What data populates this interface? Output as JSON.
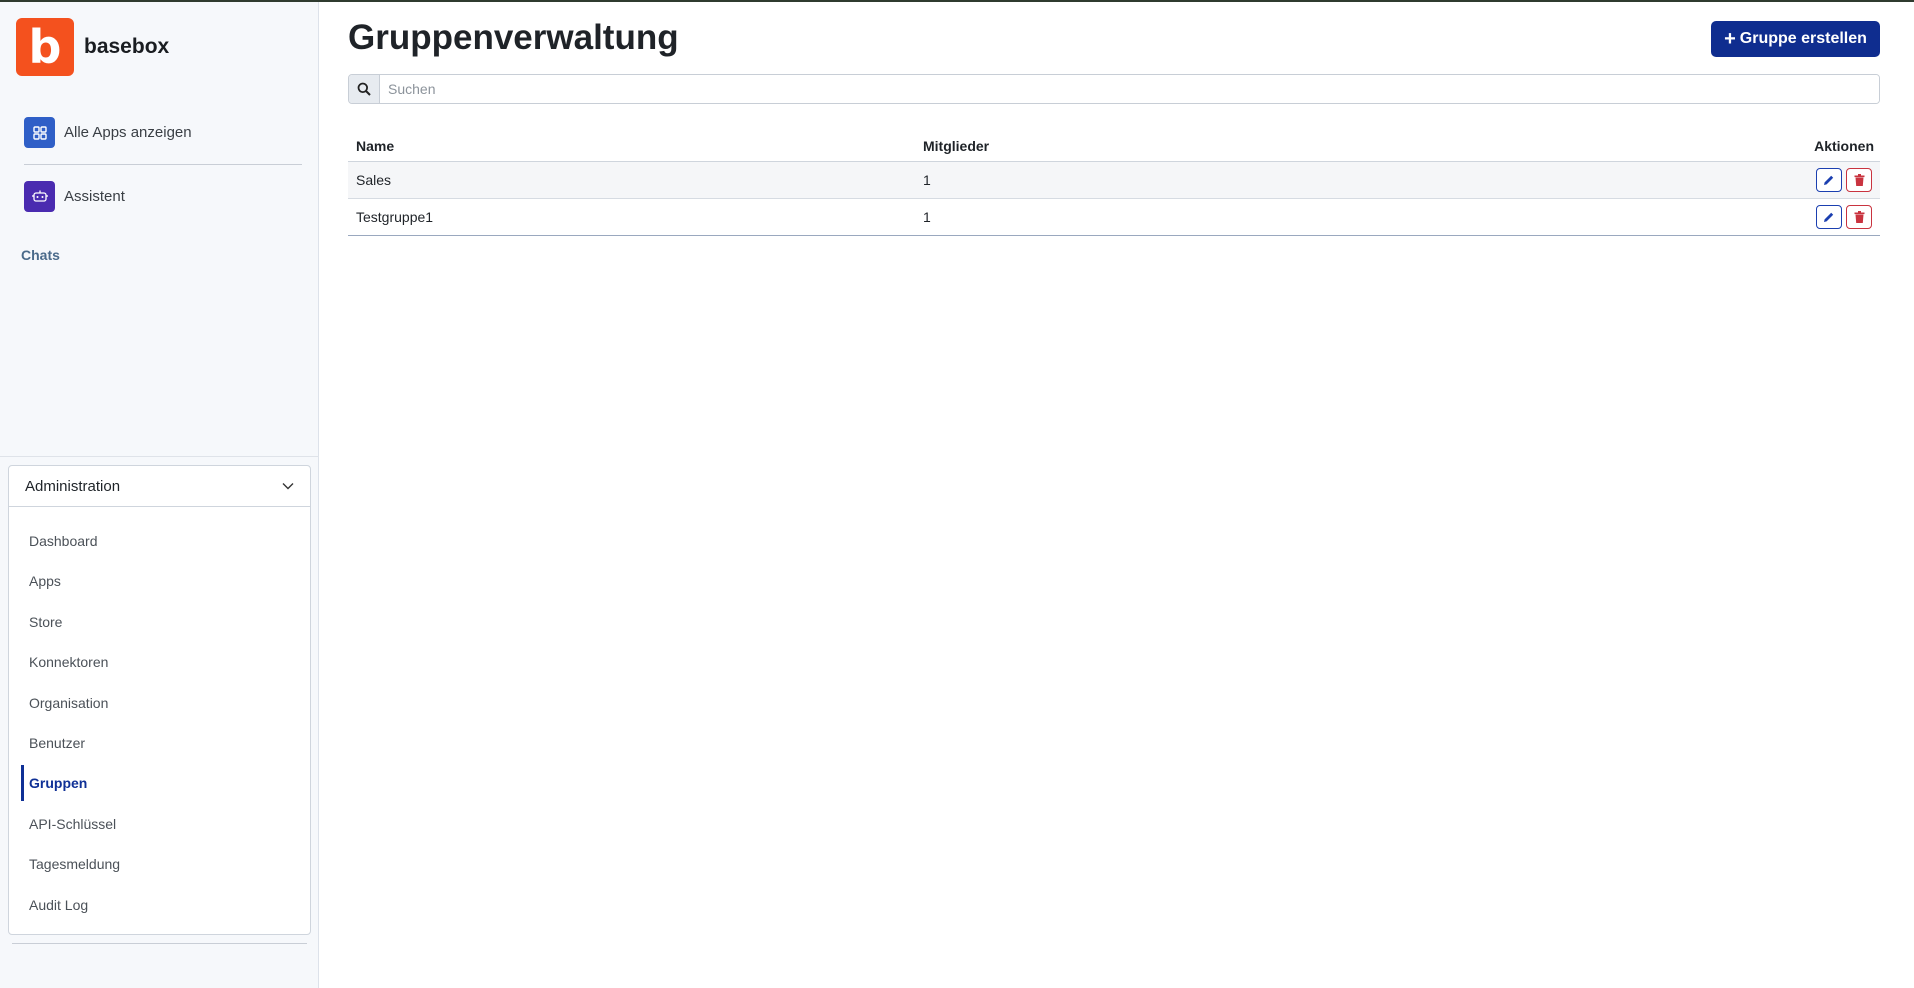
{
  "brand": {
    "logo_letter": "b",
    "name": "basebox",
    "logo_color": "#f4511e"
  },
  "sidebar": {
    "links": [
      {
        "label": "Alle Apps anzeigen",
        "icon": "apps-grid-icon"
      },
      {
        "label": "Assistent",
        "icon": "robot-icon"
      }
    ],
    "chats_label": "Chats",
    "admin": {
      "title": "Administration",
      "items": [
        {
          "label": "Dashboard"
        },
        {
          "label": "Apps"
        },
        {
          "label": "Store"
        },
        {
          "label": "Konnektoren"
        },
        {
          "label": "Organisation"
        },
        {
          "label": "Benutzer"
        },
        {
          "label": "Gruppen",
          "active": true
        },
        {
          "label": "API-Schlüssel"
        },
        {
          "label": "Tagesmeldung"
        },
        {
          "label": "Audit Log"
        }
      ]
    }
  },
  "main": {
    "title": "Gruppenverwaltung",
    "create_button": "Gruppe erstellen",
    "search_placeholder": "Suchen",
    "table": {
      "headers": {
        "name": "Name",
        "members": "Mitglieder",
        "actions": "Aktionen"
      },
      "rows": [
        {
          "name": "Sales",
          "members": "1"
        },
        {
          "name": "Testgruppe1",
          "members": "1"
        }
      ]
    }
  },
  "colors": {
    "primary": "#0f2d8f",
    "danger": "#c9333f",
    "accent_active": "#0f3096"
  }
}
